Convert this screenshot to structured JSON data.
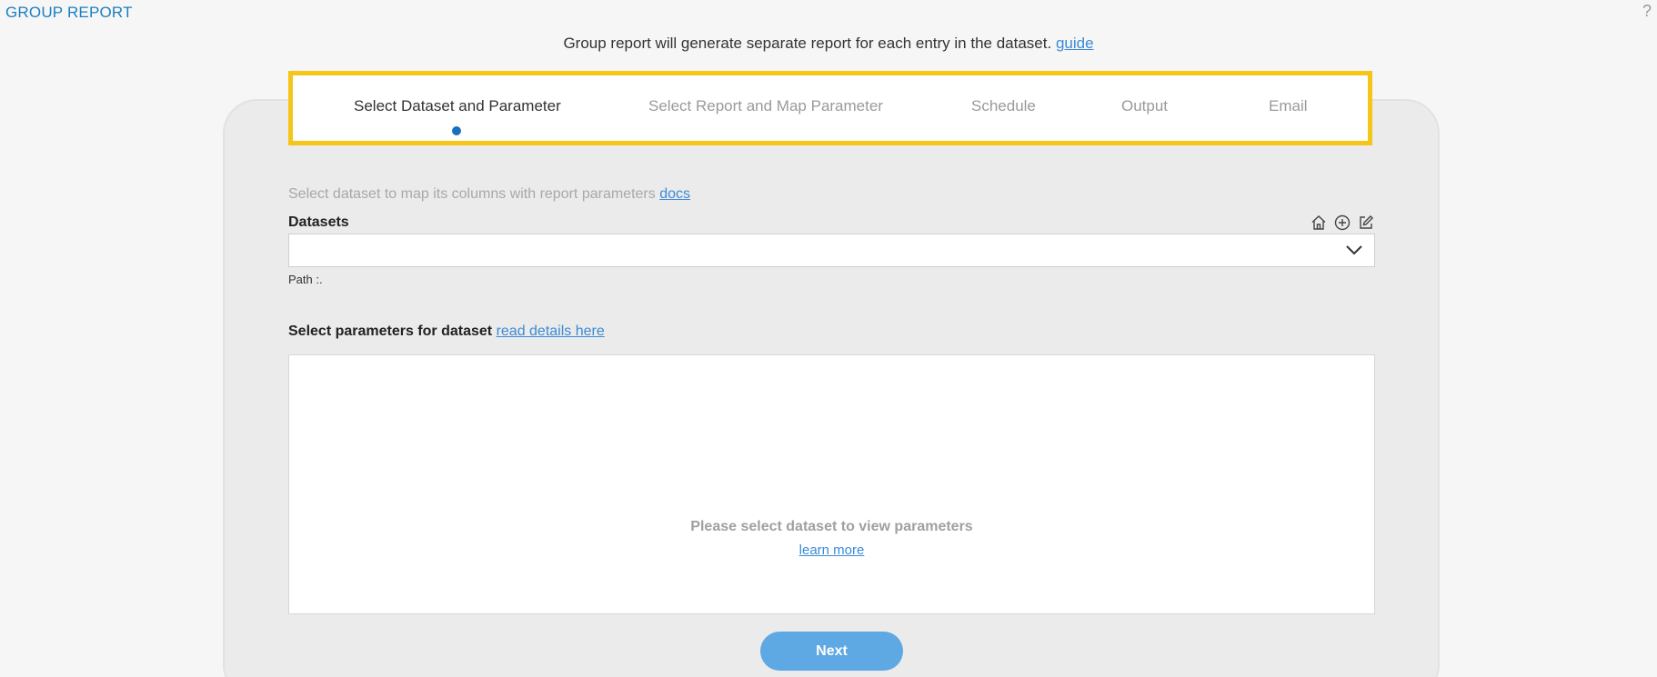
{
  "header": {
    "title": "GROUP REPORT",
    "help_glyph": "?"
  },
  "intro": {
    "text": "Group report will generate separate report for each entry in the dataset.",
    "link": "guide"
  },
  "steps": [
    {
      "label": "Select Dataset and Parameter",
      "active": true
    },
    {
      "label": "Select Report and Map Parameter",
      "active": false
    },
    {
      "label": "Schedule",
      "active": false
    },
    {
      "label": "Output",
      "active": false
    },
    {
      "label": "Email",
      "active": false
    }
  ],
  "dataset": {
    "hint": "Select dataset to map its columns with report parameters",
    "hint_link": "docs",
    "label": "Datasets",
    "selected": "",
    "path": "Path :.",
    "icons": [
      "home-icon",
      "add-circle-icon",
      "edit-icon"
    ]
  },
  "parameters": {
    "title": "Select parameters for dataset",
    "title_link": "read details here",
    "empty_message": "Please select dataset to view parameters",
    "empty_link": "learn more"
  },
  "actions": {
    "next": "Next"
  },
  "colors": {
    "accent": "#1a7fc1",
    "stepper_border": "#f5c518",
    "button": "#5ea8e3"
  }
}
